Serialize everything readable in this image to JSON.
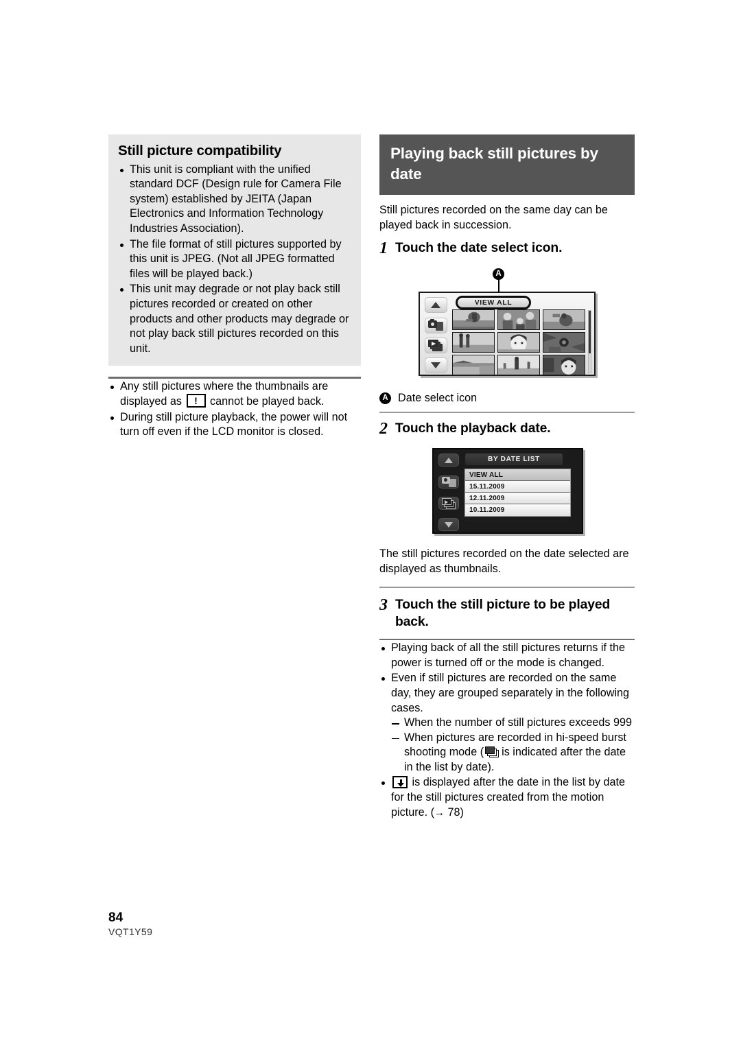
{
  "left_column": {
    "gray_box": {
      "heading": "Still picture compatibility",
      "bullets": [
        "This unit is compliant with the unified standard DCF (Design rule for Camera File system) established by JEITA (Japan Electronics and Information Technology Industries Association).",
        "The file format of still pictures supported by this unit is JPEG. (Not all JPEG formatted files will be played back.)",
        "This unit may degrade or not play back still pictures recorded or created on other products and other products may degrade or not play back still pictures recorded on this unit."
      ]
    },
    "notes": {
      "bullet1_part1": "Any still pictures where the thumbnails are displayed as",
      "bullet1_icon": "warning-exclamation-icon",
      "bullet1_part2": "cannot be played back.",
      "bullet2": "During still picture playback, the power will not turn off even if the LCD monitor is closed."
    }
  },
  "right_column": {
    "section_title": "Playing back still pictures by date",
    "intro": "Still pictures recorded on the same day can be played back in succession.",
    "step1": {
      "number": "1",
      "text": "Touch the date select icon."
    },
    "screen1": {
      "callout_label": "A",
      "view_all_button": "VIEW ALL",
      "side_buttons": [
        "scroll-up-icon",
        "photo-mode-icon",
        "video-play-mode-icon",
        "scroll-down-icon"
      ],
      "thumbnail_count": 9
    },
    "caption1": {
      "marker": "A",
      "text": "Date select icon"
    },
    "step2": {
      "number": "2",
      "text": "Touch the playback date."
    },
    "screen2": {
      "panel_title": "BY DATE LIST",
      "rows": [
        "VIEW ALL",
        "15.11.2009",
        "12.11.2009",
        "10.11.2009"
      ],
      "selected_row": "VIEW ALL",
      "side_buttons": [
        "scroll-up-icon",
        "photo-mode-icon",
        "video-play-mode-icon",
        "scroll-down-icon"
      ]
    },
    "after_step2": "The still pictures recorded on the date selected are displayed as thumbnails.",
    "step3": {
      "number": "3",
      "text": "Touch the still picture to be played back."
    },
    "final_notes": {
      "bullet1": "Playing back of all the still pictures returns if the power is turned off or the mode is changed.",
      "bullet2": "Even if still pictures are recorded on the same day, they are grouped separately in the following cases.",
      "dash1": "When the number of still pictures exceeds 999",
      "dash2_part1": "When pictures are recorded in hi-speed burst shooting mode (",
      "dash2_icon": "burst-shooting-icon",
      "dash2_part2": "is indicated after the date in the list by date).",
      "bullet3_icon": "created-from-motion-picture-icon",
      "bullet3_text": "is displayed after the date in the list by date for the still pictures created from the motion picture. (",
      "bullet3_ref_arrow": "→",
      "bullet3_ref_page": "78",
      "bullet3_close": ")"
    }
  },
  "footer": {
    "page_number": "84",
    "document_code": "VQT1Y59"
  },
  "colors": {
    "section_header_bg": "#555555",
    "gray_box_bg": "#e7e7e7",
    "rule_dark": "#6e6e6e",
    "rule_light": "#9a9a9a",
    "lcd_dark_bg": "#1b1b1b"
  }
}
